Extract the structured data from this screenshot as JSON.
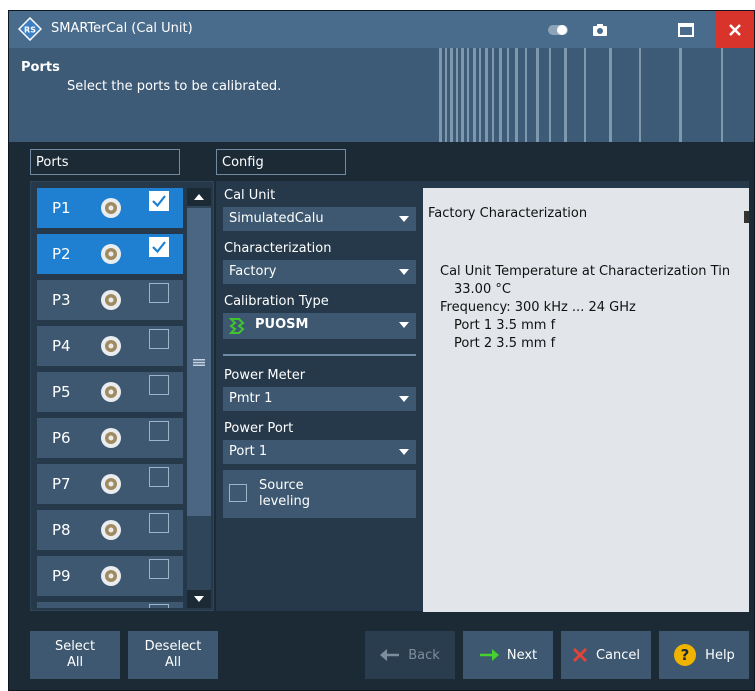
{
  "window": {
    "title": "SMARTerCal (Cal Unit)"
  },
  "header": {
    "title": "Ports",
    "subtitle": "Select the ports to be calibrated."
  },
  "sections": {
    "ports_label": "Ports",
    "config_label": "Config"
  },
  "ports": [
    {
      "label": "P1",
      "checked": true
    },
    {
      "label": "P2",
      "checked": true
    },
    {
      "label": "P3",
      "checked": false
    },
    {
      "label": "P4",
      "checked": false
    },
    {
      "label": "P5",
      "checked": false
    },
    {
      "label": "P6",
      "checked": false
    },
    {
      "label": "P7",
      "checked": false
    },
    {
      "label": "P8",
      "checked": false
    },
    {
      "label": "P9",
      "checked": false
    }
  ],
  "config": {
    "cal_unit_label": "Cal Unit",
    "cal_unit_value": "SimulatedCalu",
    "characterization_label": "Characterization",
    "characterization_value": "Factory",
    "calibration_type_label": "Calibration Type",
    "calibration_type_value": "PUOSM",
    "power_meter_label": "Power Meter",
    "power_meter_value": "Pmtr 1",
    "power_port_label": "Power Port",
    "power_port_value": "Port 1",
    "source_leveling_line1": "Source",
    "source_leveling_line2": "leveling"
  },
  "characterization_info": {
    "heading": "Factory Characterization",
    "temperature_label": "Cal Unit Temperature at Characterization Tin",
    "temperature_value": "33.00 °C",
    "frequency": "Frequency: 300 kHz ... 24 GHz",
    "port1": "Port 1 3.5 mm f",
    "port2": "Port 2 3.5 mm f"
  },
  "buttons": {
    "select_all_line1": "Select",
    "select_all_line2": "All",
    "deselect_all_line1": "Deselect",
    "deselect_all_line2": "All",
    "back": "Back",
    "next": "Next",
    "cancel": "Cancel",
    "help": "Help"
  },
  "colors": {
    "accent": "#1f7fd1",
    "close": "#d9342b",
    "next_arrow": "#46d12c",
    "help": "#f0b400"
  }
}
